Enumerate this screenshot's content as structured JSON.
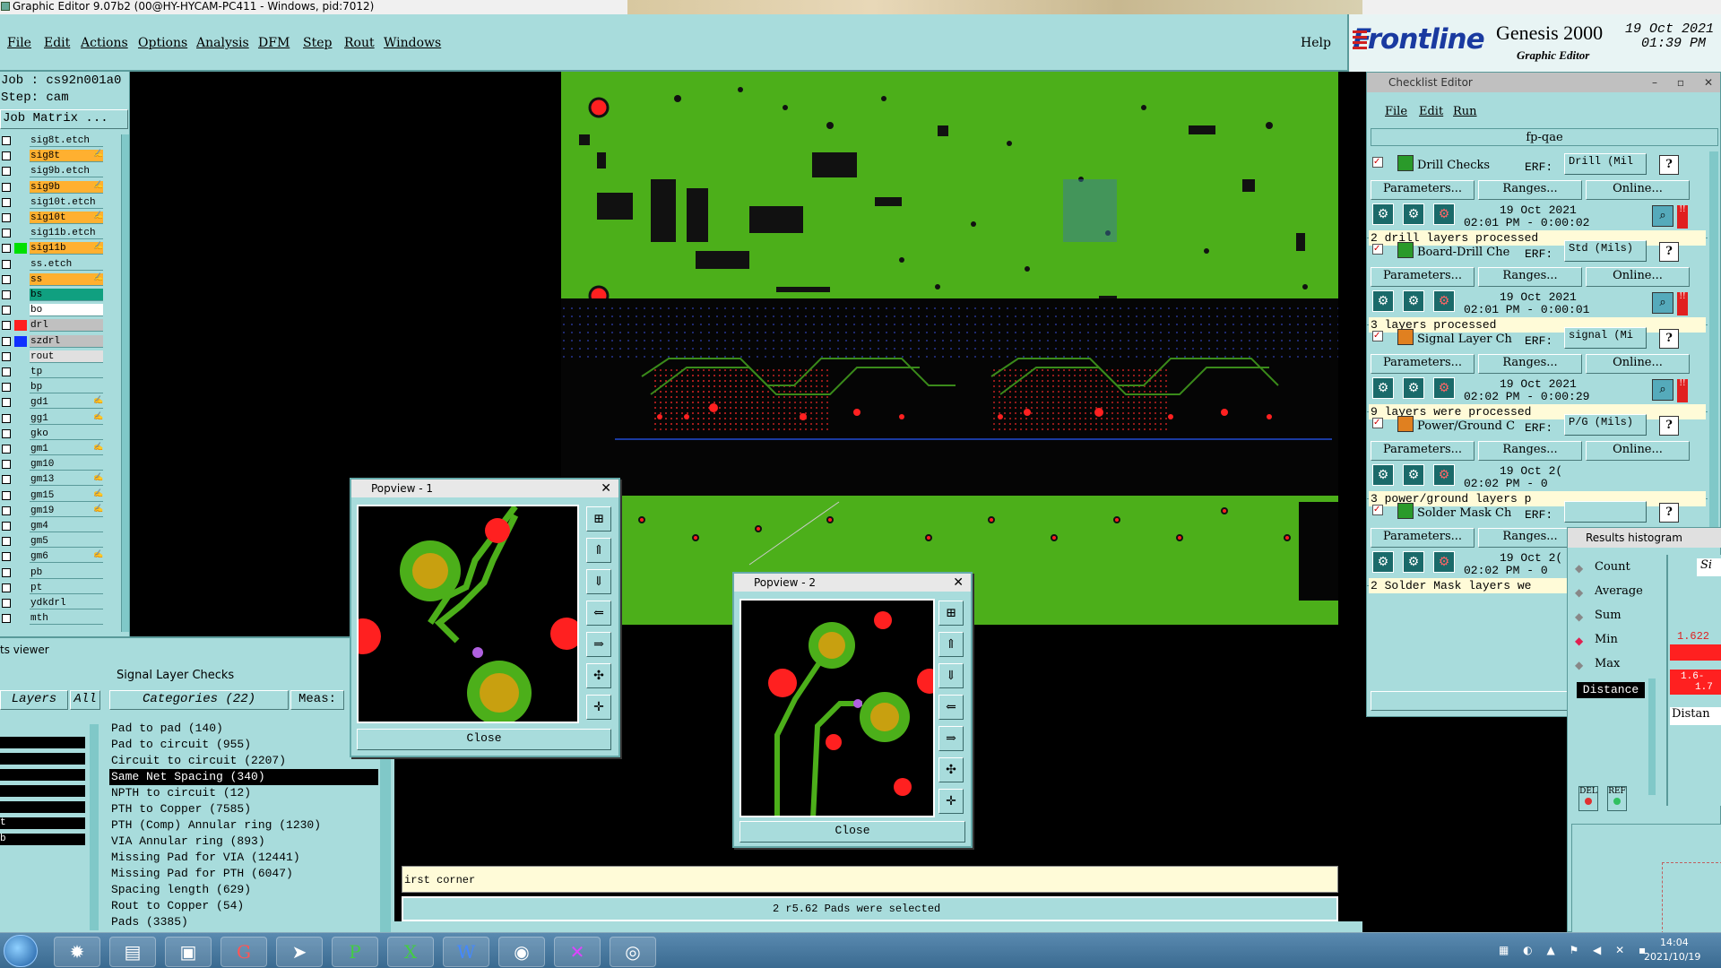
{
  "window": {
    "title": "Graphic Editor 9.07b2 (00@HY-HYCAM-PC411 - Windows, pid:7012)"
  },
  "menu": {
    "items": [
      "File",
      "Edit",
      "Actions",
      "Options",
      "Analysis",
      "DFM",
      "Step",
      "Rout",
      "Windows"
    ],
    "help": "Help"
  },
  "logo": {
    "brand": "Frontline",
    "product": "Genesis 2000",
    "subtitle": "Graphic Editor",
    "date": "19 Oct 2021",
    "time": "01:39 PM"
  },
  "job": {
    "job_label": "Job : cs92n001a0",
    "step_label": "Step: cam",
    "matrix_button": "Job Matrix ..."
  },
  "layers": [
    {
      "name": "sig8t.etch",
      "color": "#a8dcdc",
      "swatch": ""
    },
    {
      "name": "sig8t",
      "color": "#ffb030",
      "swatch": "",
      "mark": "✍"
    },
    {
      "name": "sig9b.etch",
      "color": "#a8dcdc",
      "swatch": ""
    },
    {
      "name": "sig9b",
      "color": "#ffb030",
      "swatch": "",
      "mark": "✍"
    },
    {
      "name": "sig10t.etch",
      "color": "#a8dcdc",
      "swatch": ""
    },
    {
      "name": "sig10t",
      "color": "#ffb030",
      "swatch": "",
      "mark": "✍"
    },
    {
      "name": "sig11b.etch",
      "color": "#a8dcdc",
      "swatch": ""
    },
    {
      "name": "sig11b",
      "color": "#ffb030",
      "swatch": "#00e000",
      "mark": "✍"
    },
    {
      "name": "ss.etch",
      "color": "#a8dcdc",
      "swatch": ""
    },
    {
      "name": "ss",
      "color": "#ffb030",
      "swatch": "",
      "mark": "✍"
    },
    {
      "name": "bs",
      "color": "#10a080",
      "swatch": ""
    },
    {
      "name": "bo",
      "color": "#ffffff",
      "swatch": ""
    },
    {
      "name": "drl",
      "color": "#c0c0c0",
      "swatch": "#ff2020"
    },
    {
      "name": "szdrl",
      "color": "#c0c0c0",
      "swatch": "#1030ff"
    },
    {
      "name": "rout",
      "color": "#e0e0e0",
      "swatch": ""
    },
    {
      "name": "tp",
      "color": "#a8dcdc",
      "swatch": ""
    },
    {
      "name": "bp",
      "color": "#a8dcdc",
      "swatch": ""
    },
    {
      "name": "gd1",
      "color": "#a8dcdc",
      "swatch": "",
      "mark": "✍"
    },
    {
      "name": "gg1",
      "color": "#a8dcdc",
      "swatch": "",
      "mark": "✍"
    },
    {
      "name": "gko",
      "color": "#a8dcdc",
      "swatch": ""
    },
    {
      "name": "gm1",
      "color": "#a8dcdc",
      "swatch": "",
      "mark": "✍"
    },
    {
      "name": "gm10",
      "color": "#a8dcdc",
      "swatch": ""
    },
    {
      "name": "gm13",
      "color": "#a8dcdc",
      "swatch": "",
      "mark": "✍"
    },
    {
      "name": "gm15",
      "color": "#a8dcdc",
      "swatch": "",
      "mark": "✍"
    },
    {
      "name": "gm19",
      "color": "#a8dcdc",
      "swatch": "",
      "mark": "✍"
    },
    {
      "name": "gm4",
      "color": "#a8dcdc",
      "swatch": ""
    },
    {
      "name": "gm5",
      "color": "#a8dcdc",
      "swatch": ""
    },
    {
      "name": "gm6",
      "color": "#a8dcdc",
      "swatch": "",
      "mark": "✍"
    },
    {
      "name": "pb",
      "color": "#a8dcdc",
      "swatch": ""
    },
    {
      "name": "pt",
      "color": "#a8dcdc",
      "swatch": ""
    },
    {
      "name": "ydkdrl",
      "color": "#a8dcdc",
      "swatch": ""
    },
    {
      "name": "mth",
      "color": "#a8dcdc",
      "swatch": ""
    }
  ],
  "results_viewer": {
    "title": "ts viewer",
    "heading": "Signal Layer Checks",
    "layers_label": "Layers",
    "all_label": "All",
    "categories_label": "Categories (22)",
    "meas_label": "Meas:",
    "categories": [
      "Pad to pad (140)",
      "Pad to circuit (955)",
      "Circuit to circuit (2207)",
      "Same Net Spacing (340)",
      "NPTH to circuit (12)",
      "PTH to Copper (7585)",
      "PTH (Comp) Annular ring (1230)",
      "VIA Annular ring (893)",
      "Missing Pad for VIA (12441)",
      "Missing Pad for PTH (6047)",
      "Spacing length (629)",
      "Rout to Copper (54)",
      "Pads (3385)"
    ],
    "layer_rows": [
      "",
      "",
      "",
      "",
      "",
      "t",
      "b"
    ]
  },
  "popview1": {
    "title": "Popview - 1",
    "close": "Close"
  },
  "popview2": {
    "title": "Popview - 2",
    "close": "Close"
  },
  "status": {
    "prompt": "irst corner",
    "message": "2 r5.62 Pads were selected"
  },
  "checklist": {
    "title": "Checklist Editor",
    "menu": [
      "File",
      "Edit",
      "Run"
    ],
    "name": "fp-qae",
    "params_label": "Parameters...",
    "ranges_label": "Ranges...",
    "online_label": "Online...",
    "erf_label": "ERF:",
    "close": "Close",
    "checks": [
      {
        "name": "Drill Checks",
        "erf": "Drill (Mil",
        "date": "19 Oct 2021",
        "time": "02:01 PM - 0:00:02",
        "result": "2 drill layers processed"
      },
      {
        "name": "Board-Drill Che",
        "erf": "Std (Mils)",
        "date": "19 Oct 2021",
        "time": "02:01 PM - 0:00:01",
        "result": "3 layers processed"
      },
      {
        "name": "Signal Layer Ch",
        "erf": "signal (Mi",
        "date": "19 Oct 2021",
        "time": "02:02 PM - 0:00:29",
        "result": "9 layers were processed"
      },
      {
        "name": "Power/Ground C",
        "erf": "P/G (Mils)",
        "date": "19 Oct 2(",
        "time": "02:02 PM - 0",
        "result": "3 power/ground layers p"
      },
      {
        "name": "Solder Mask Ch",
        "erf": "",
        "date": "19 Oct 2(",
        "time": "02:02 PM - 0",
        "result": "2 Solder Mask layers we"
      }
    ]
  },
  "histogram": {
    "title": "Results histogram",
    "options": [
      "Count",
      "Average",
      "Sum",
      "Min",
      "Max"
    ],
    "selected": "Min",
    "measure": "Distance",
    "value1": "1.622",
    "value2": "1.6-",
    "value3": "1.7",
    "dist_label": "Distan",
    "si_label": "Si",
    "del": "DEL",
    "ref": "REF"
  },
  "taskbar": {
    "time": "14:04",
    "date": "2021/10/19"
  }
}
